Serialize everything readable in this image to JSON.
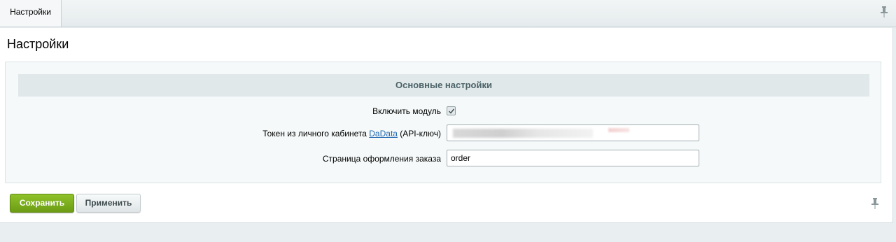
{
  "tab": {
    "label": "Настройки"
  },
  "page": {
    "title": "Настройки"
  },
  "section": {
    "title": "Основные настройки"
  },
  "fields": {
    "enable_module": {
      "label": "Включить модуль",
      "checked": true
    },
    "token": {
      "label_prefix": "Токен из личного кабинета ",
      "label_link": "DaData",
      "label_suffix": " (API-ключ)",
      "value_hidden": true
    },
    "order_page": {
      "label": "Страница оформления заказа",
      "value": "order"
    }
  },
  "buttons": {
    "save_label": "Сохранить",
    "apply_label": "Применить"
  },
  "icons": {
    "pin": "pin-icon",
    "checkmark": "checkmark-icon"
  },
  "colors": {
    "save_button": "#7aad1c",
    "link": "#2067b0",
    "section_header_bg": "#e0e8ea"
  }
}
